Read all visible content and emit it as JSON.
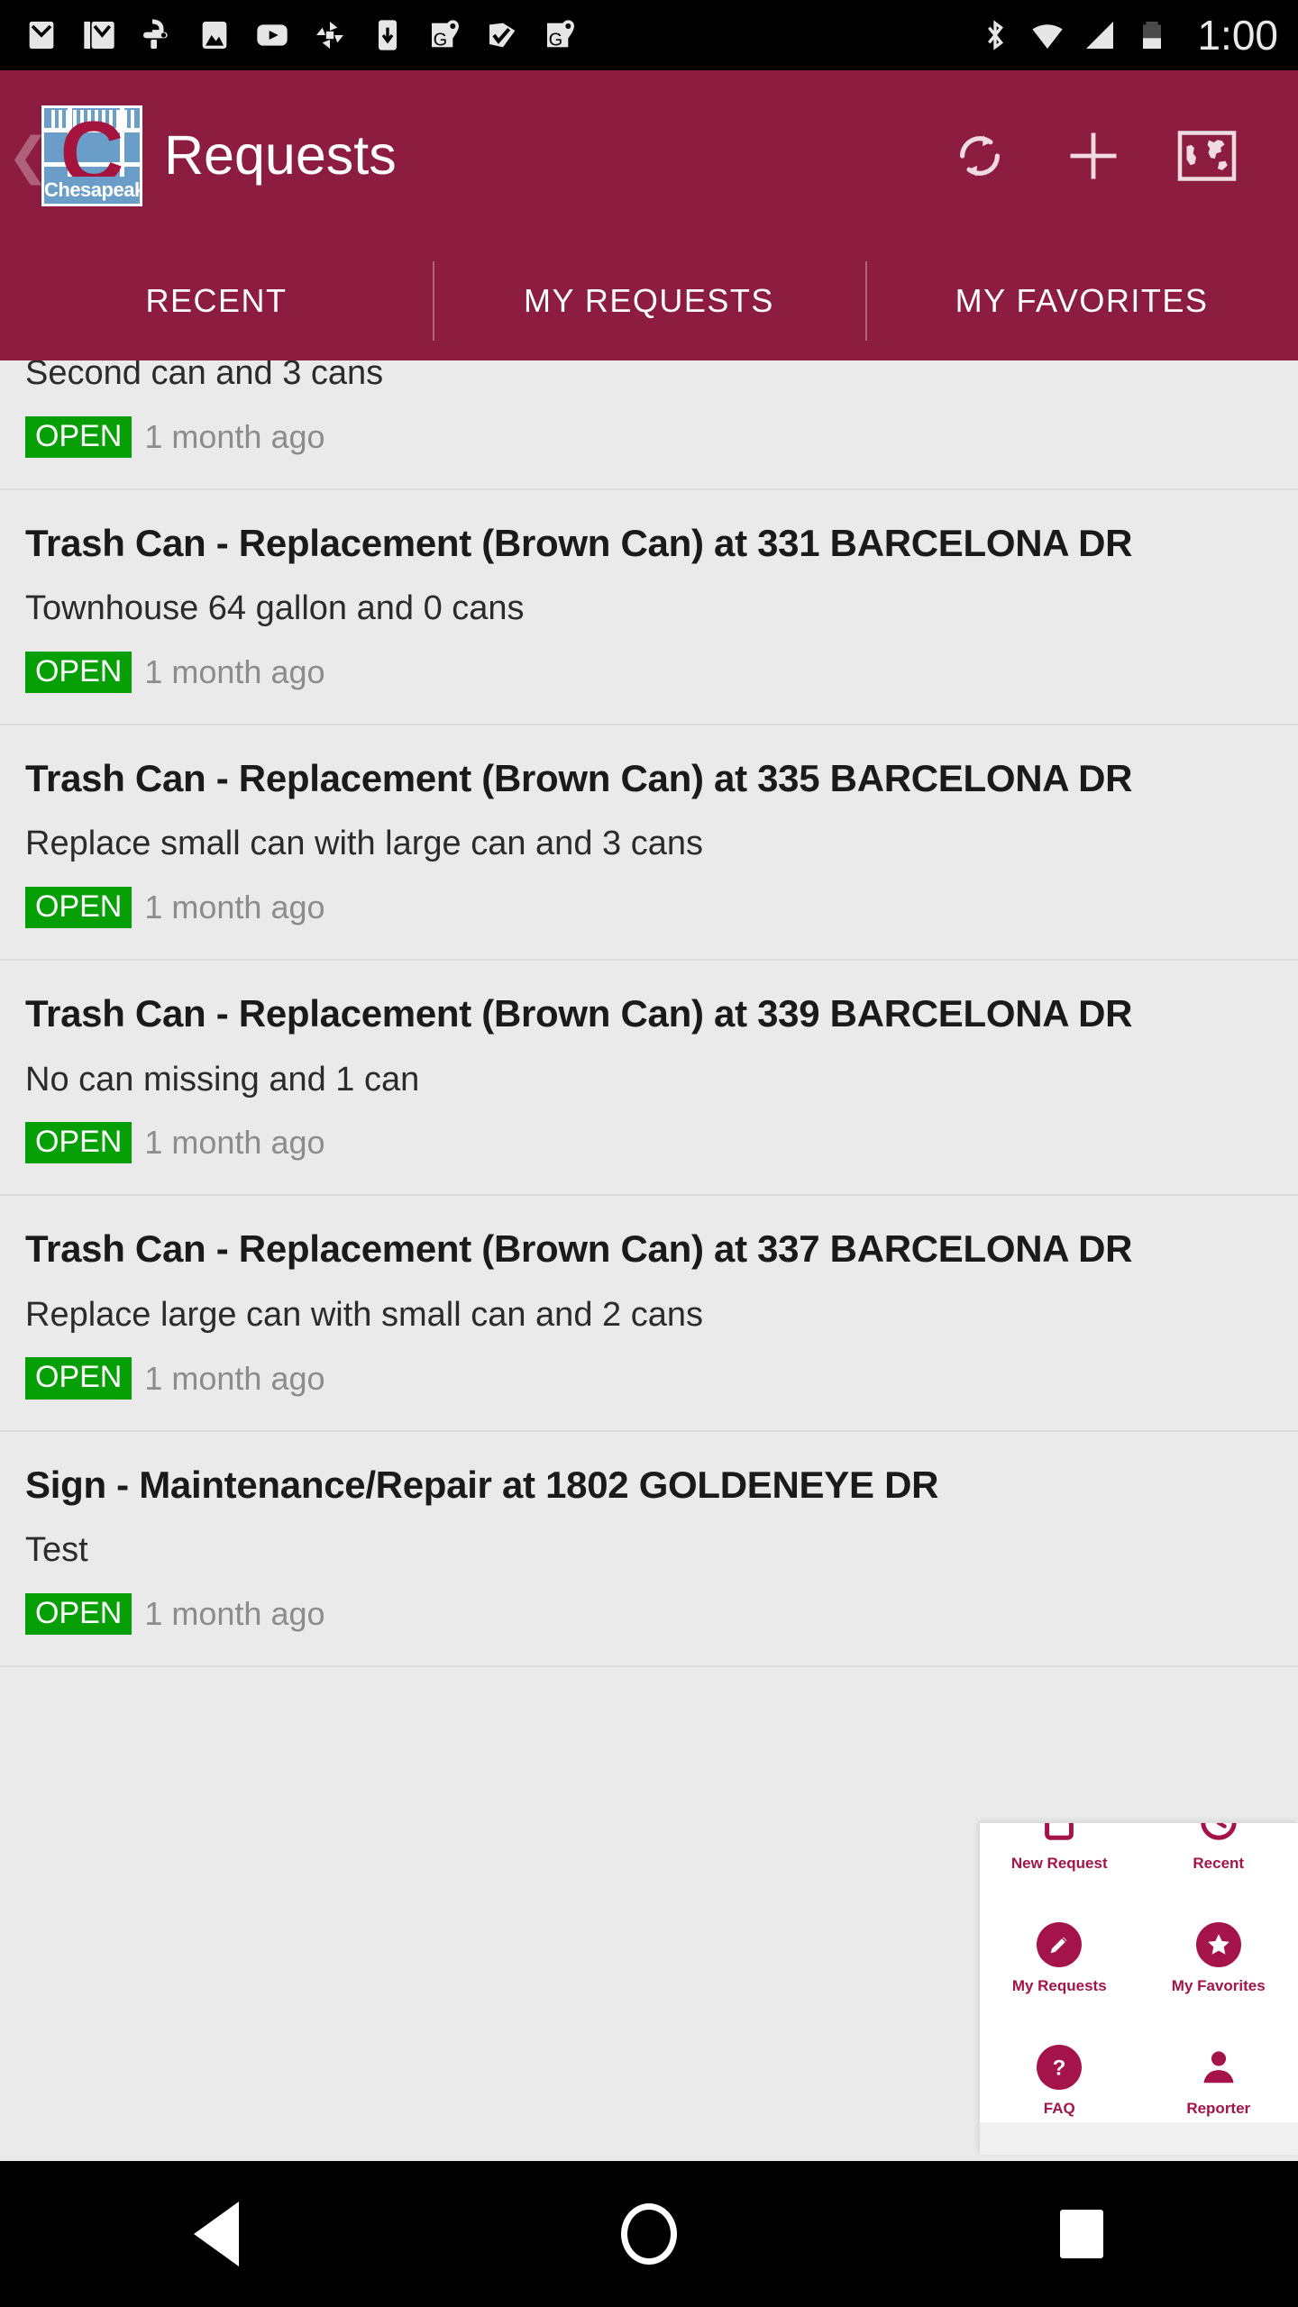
{
  "statusbar": {
    "time": "1:00",
    "left_icons": [
      "gmail-icon",
      "gmail-icon",
      "hangouts-icon",
      "photos-icon",
      "youtube-icon",
      "pinwheel-icon",
      "download-icon",
      "google-maps-icon",
      "tasks-check-icon",
      "google-maps-icon"
    ],
    "right_icons": [
      "bluetooth-icon",
      "wifi-icon",
      "cell-signal-icon",
      "battery-icon"
    ]
  },
  "appbar": {
    "back_label": "❮",
    "logo_letter": "C",
    "logo_name": "Chesapeake",
    "title": "Requests",
    "actions": [
      {
        "name": "refresh-button",
        "icon": "refresh-icon"
      },
      {
        "name": "add-request-button",
        "icon": "plus-icon"
      },
      {
        "name": "map-view-button",
        "icon": "world-map-icon"
      }
    ]
  },
  "tabs": {
    "items": [
      {
        "label": "RECENT",
        "active": true
      },
      {
        "label": "MY REQUESTS",
        "active": false
      },
      {
        "label": "MY FAVORITES",
        "active": false
      }
    ]
  },
  "list": {
    "items": [
      {
        "title": "",
        "desc": "Second can and 3 cans",
        "status": "OPEN",
        "time": "1 month ago",
        "clipped": true
      },
      {
        "title": "Trash Can - Replacement (Brown Can) at 331 BARCELONA DR",
        "desc": "Townhouse 64 gallon and 0 cans",
        "status": "OPEN",
        "time": "1 month ago"
      },
      {
        "title": "Trash Can - Replacement (Brown Can) at 335 BARCELONA DR",
        "desc": "Replace small can with large can and 3 cans",
        "status": "OPEN",
        "time": "1 month ago"
      },
      {
        "title": "Trash Can - Replacement (Brown Can) at 339 BARCELONA DR",
        "desc": "No can missing and 1 can",
        "status": "OPEN",
        "time": "1 month ago"
      },
      {
        "title": "Trash Can - Replacement (Brown Can) at 337 BARCELONA DR",
        "desc": "Replace large can with small can and 2 cans",
        "status": "OPEN",
        "time": "1 month ago"
      },
      {
        "title": "Sign - Maintenance/Repair at 1802 GOLDENEYE DR",
        "desc": "Test",
        "status": "OPEN",
        "time": "1 month ago"
      }
    ]
  },
  "overlay_panel": {
    "cells": [
      {
        "label": "New Request",
        "icon": "clipboard-icon"
      },
      {
        "label": "Recent",
        "icon": "clock-icon"
      },
      {
        "label": "My Requests",
        "icon": "pencil-icon"
      },
      {
        "label": "My Favorites",
        "icon": "star-icon"
      },
      {
        "label": "FAQ",
        "icon": "question-mark-icon"
      },
      {
        "label": "Reporter",
        "icon": "person-icon"
      }
    ]
  },
  "navbar": {
    "back": "back-triangle-icon",
    "home": "home-circle-icon",
    "recents": "recents-square-icon"
  },
  "colors": {
    "brand": "#8c1d41",
    "accent_blue": "#5b93c8",
    "status_open": "#06a006",
    "list_bg": "#eaeaea",
    "panel_icon": "#a4144a"
  }
}
